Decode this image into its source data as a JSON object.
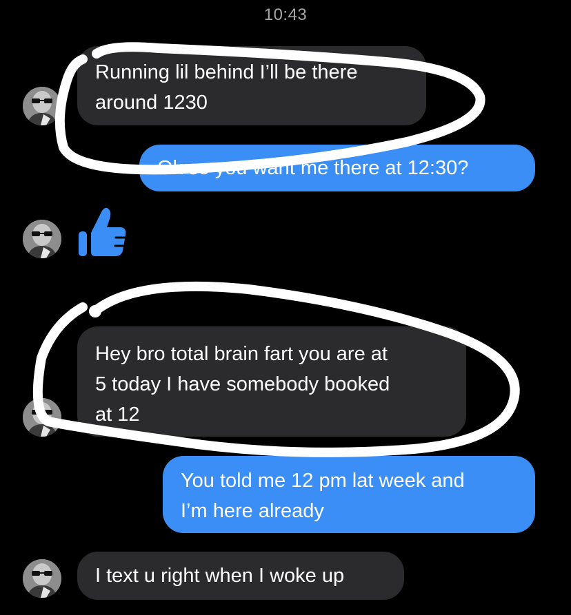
{
  "timestamps": {
    "first": "10:43"
  },
  "messages": [
    {
      "sender": "them",
      "text": "Running lil behind I’ll be there\naround 1230"
    },
    {
      "sender": "me",
      "text": "Ok so you want me there at 12:30?"
    },
    {
      "sender": "them",
      "type": "reaction",
      "icon": "thumbs-up-icon",
      "color": "#3a8ef6"
    },
    {
      "sender": "them",
      "text": "Hey bro total brain fart you are at\n5 today I have somebody booked\nat 12"
    },
    {
      "sender": "me",
      "text": "You told me 12 pm lat week and\nI’m here already"
    },
    {
      "sender": "them",
      "text": "I text u right when I woke up"
    }
  ],
  "colors": {
    "incoming_bubble": "#2b2b2d",
    "outgoing_bubble": "#3a8ef6",
    "background": "#000000",
    "annotation_stroke": "#ffffff"
  }
}
